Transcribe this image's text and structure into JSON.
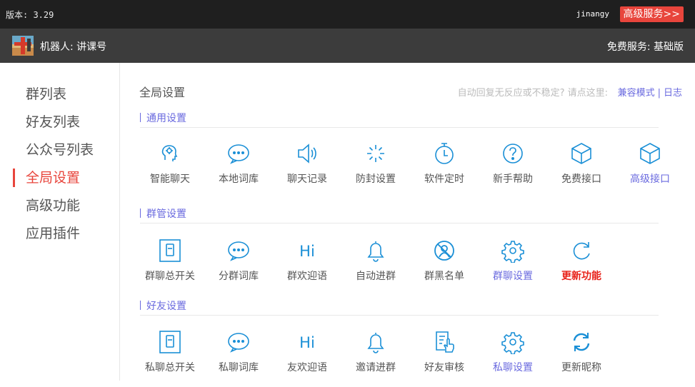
{
  "topbar": {
    "version": "版本: 3.29",
    "user": "jinangy",
    "premium": "高级服务>>"
  },
  "subbar": {
    "robot": "机器人: 讲课号",
    "plan": "免费服务: 基础版"
  },
  "sidebar": {
    "items": [
      "群列表",
      "好友列表",
      "公众号列表",
      "全局设置",
      "高级功能",
      "应用插件"
    ],
    "active": "全局设置"
  },
  "main": {
    "title": "全局设置",
    "hint": "自动回复无反应或不稳定? 请点这里:",
    "links": [
      "兼容模式",
      "日志"
    ]
  },
  "sections": [
    {
      "title": "通用设置",
      "items": [
        {
          "label": "智能聊天",
          "icon": "brain-icon"
        },
        {
          "label": "本地词库",
          "icon": "chat-bubble-icon"
        },
        {
          "label": "聊天记录",
          "icon": "speaker-icon"
        },
        {
          "label": "防封设置",
          "icon": "loading-icon"
        },
        {
          "label": "软件定时",
          "icon": "timer-icon"
        },
        {
          "label": "新手帮助",
          "icon": "help-icon"
        },
        {
          "label": "免费接口",
          "icon": "cube-icon"
        },
        {
          "label": "高级接口",
          "icon": "cube-icon",
          "style": "blue"
        }
      ]
    },
    {
      "title": "群管设置",
      "items": [
        {
          "label": "群聊总开关",
          "icon": "switch-icon"
        },
        {
          "label": "分群词库",
          "icon": "chat-bubble-icon"
        },
        {
          "label": "群欢迎语",
          "icon": "hi-icon"
        },
        {
          "label": "自动进群",
          "icon": "bell-icon"
        },
        {
          "label": "群黑名单",
          "icon": "blocked-user-icon"
        },
        {
          "label": "群聊设置",
          "icon": "gear-icon",
          "style": "blue"
        },
        {
          "label": "更新功能",
          "icon": "refresh-icon",
          "style": "red"
        }
      ]
    },
    {
      "title": "好友设置",
      "items": [
        {
          "label": "私聊总开关",
          "icon": "switch-icon"
        },
        {
          "label": "私聊词库",
          "icon": "chat-bubble-icon"
        },
        {
          "label": "友欢迎语",
          "icon": "hi-icon"
        },
        {
          "label": "邀请进群",
          "icon": "bell-icon"
        },
        {
          "label": "好友审核",
          "icon": "review-hand-icon"
        },
        {
          "label": "私聊设置",
          "icon": "gear-icon",
          "style": "blue"
        },
        {
          "label": "更新昵称",
          "icon": "sync-icon"
        }
      ]
    }
  ],
  "colors": {
    "accent": "#1a8fd6",
    "link": "#6a6adf",
    "danger": "#e8453c"
  }
}
